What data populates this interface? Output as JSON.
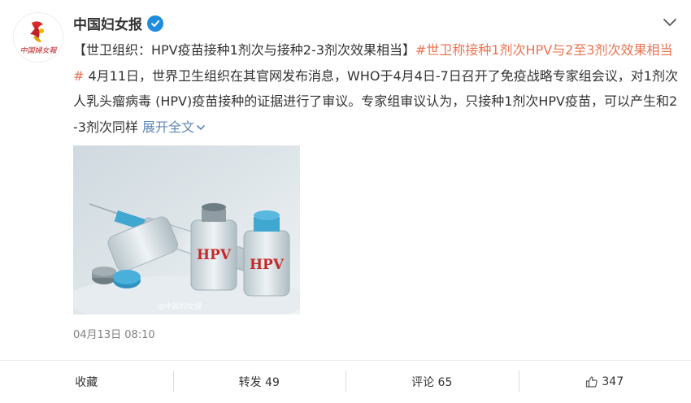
{
  "account": {
    "name": "中国妇女报",
    "avatar_text": "中国婦女報"
  },
  "post": {
    "headline": "【世卫组织：HPV疫苗接种1剂次与接种2-3剂次效果相当】",
    "hashtag": "#世卫称接种1剂次HPV与2至3剂次效果相当#",
    "body": " 4月11日，世界卫生组织在其官网发布消息，WHO于4月4日-7日召开了免疫战略专家组会议，对1剂次人乳头瘤病毒 (HPV)疫苗接种的证据进行了审议。专家组审议认为，只接种1剂次HPV疫苗，可以产生和2-3剂次同样 ",
    "expand_label": "展开全文",
    "timestamp": "04月13日 08:10"
  },
  "image": {
    "vial_label_1": "HPV",
    "vial_label_2": "HPV",
    "watermark": "@中国妇女报"
  },
  "toolbar": {
    "favorite": "收藏",
    "repost": "转发 49",
    "comment": "评论 65",
    "like": "347"
  },
  "colors": {
    "link": "#eb7350",
    "expand": "#5d87b5",
    "verified": "#1e8ddd",
    "vial_cap": "#3fa7d0"
  }
}
